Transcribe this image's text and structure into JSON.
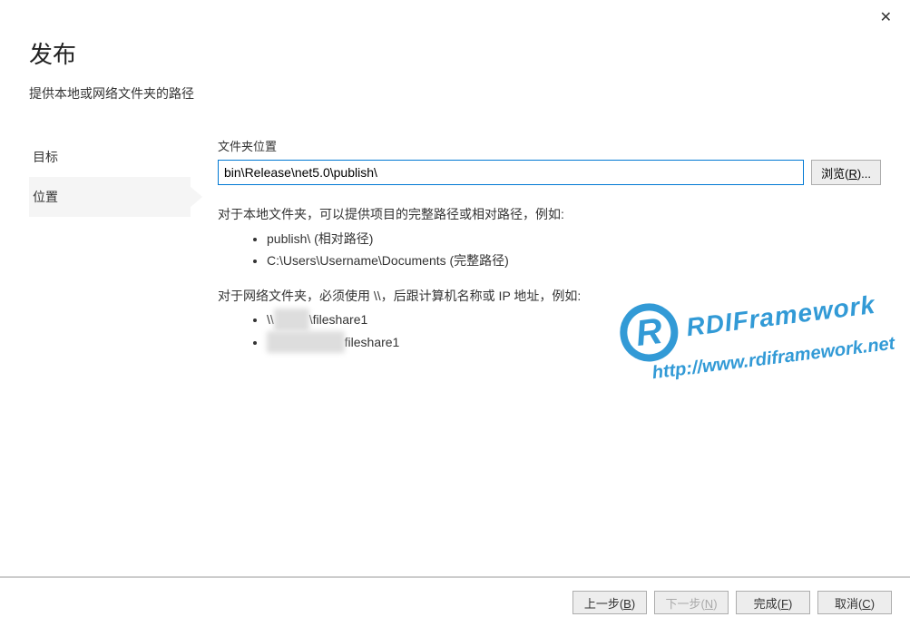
{
  "close_label": "✕",
  "header": {
    "title": "发布",
    "subtitle": "提供本地或网络文件夹的路径"
  },
  "sidebar": {
    "items": [
      {
        "label": "目标",
        "active": false
      },
      {
        "label": "位置",
        "active": true
      }
    ]
  },
  "form": {
    "folder_label": "文件夹位置",
    "folder_value": "bin\\Release\\net5.0\\publish\\",
    "browse_label": "浏览(",
    "browse_mn": "R",
    "browse_tail": ")..."
  },
  "help": {
    "p1": "对于本地文件夹，可以提供项目的完整路径或相对路径，例如:",
    "li1": "publish\\ (相对路径)",
    "li2": "C:\\Users\\Username\\Documents (完整路径)",
    "p2": "对于网络文件夹，必须使用 \\\\，后跟计算机名称或 IP 地址，例如:",
    "li3_pre": "\\\\",
    "li3_blur": "server",
    "li3_post": "\\fileshare1",
    "li4_blur": "\\\\192.168.0.1\\",
    "li4_post": "fileshare1"
  },
  "watermark": {
    "badge": "R",
    "line1": "RDIFramework",
    "line2": "http://www.rdiframework.net"
  },
  "footer": {
    "back": {
      "t": "上一步(",
      "mn": "B",
      "tail": ")"
    },
    "next": {
      "t": "下一步(",
      "mn": "N",
      "tail": ")"
    },
    "finish": {
      "t": "完成(",
      "mn": "F",
      "tail": ")"
    },
    "cancel": {
      "t": "取消(",
      "mn": "C",
      "tail": ")"
    }
  }
}
